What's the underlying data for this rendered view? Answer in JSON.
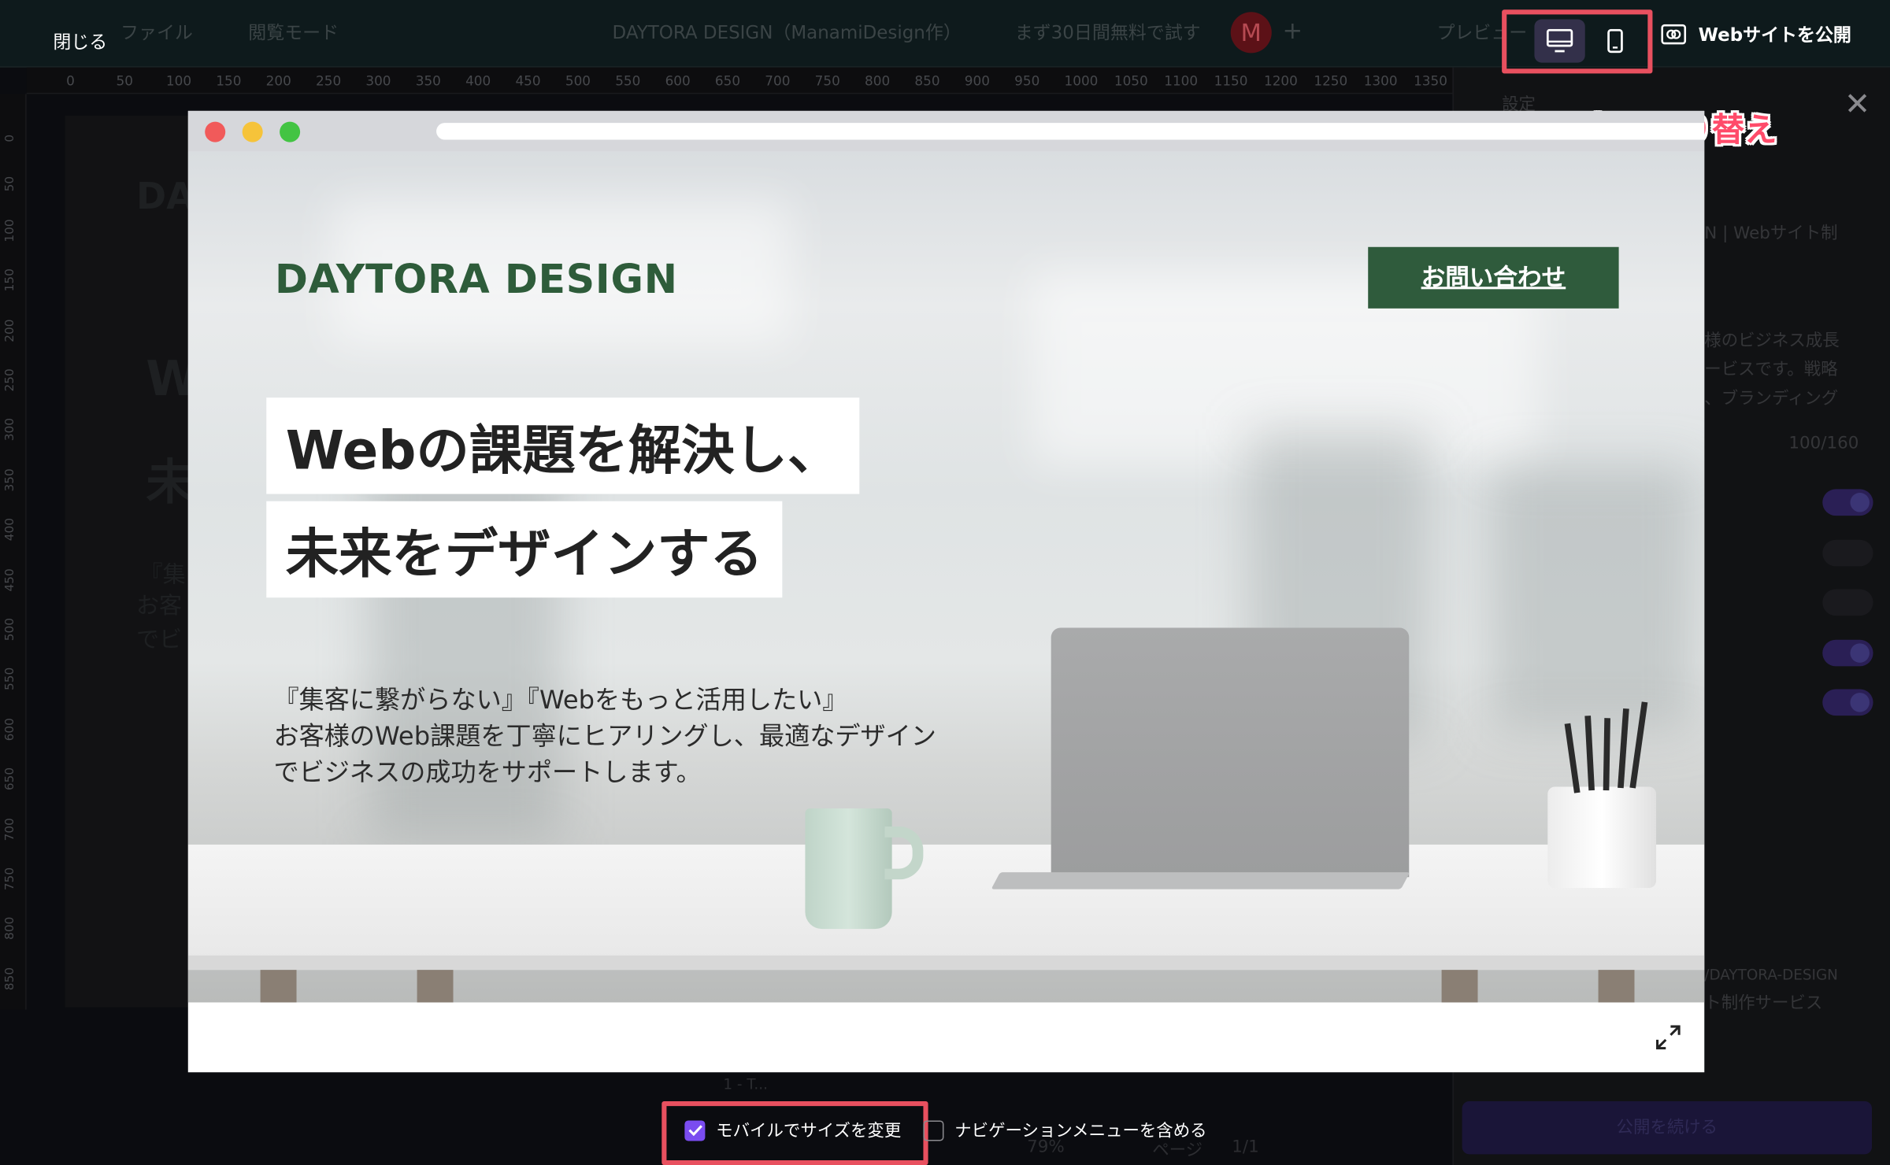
{
  "topbar": {
    "close_label": "閉じる",
    "file_label": "ファイル",
    "view_mode_label": "閲覧モード",
    "doc_title": "DAYTORA DESIGN（ManamiDesign作）",
    "trial_label": "まず30日間無料で試す",
    "avatar_initial": "M",
    "plus": "+",
    "preview_label": "プレビュー",
    "publish_web_label": "Webサイトを公開"
  },
  "annotation": {
    "device_toggle_caption": "パソコン・スマホ表示切り替え"
  },
  "ruler": {
    "h_ticks": [
      "0",
      "50",
      "100",
      "150",
      "200",
      "250",
      "300",
      "350",
      "400",
      "450",
      "500",
      "550",
      "600",
      "650",
      "700",
      "750",
      "800",
      "850",
      "900",
      "950",
      "1000",
      "1050",
      "1100",
      "1150",
      "1200",
      "1250",
      "1300",
      "1350"
    ],
    "v_ticks": [
      "0",
      "50",
      "100",
      "150",
      "200",
      "250",
      "300",
      "350",
      "400",
      "450",
      "500",
      "550",
      "600",
      "650",
      "700",
      "750",
      "800",
      "850"
    ]
  },
  "background_canvas": {
    "peek_brand": "DA",
    "peek_w": "W",
    "peek_mi": "未",
    "peek_line1": "『集",
    "peek_line2": "お客",
    "peek_line3": "でビ"
  },
  "right_panel": {
    "back_label": "設定",
    "title_snippet": "N | Webサイト制",
    "desc_lines": [
      "様のビジネス成長",
      "ービスです。戦略",
      "、ブランディング"
    ],
    "char_count": "100/160",
    "toggles": [
      true,
      false,
      false,
      true,
      true
    ],
    "thumb_caption_1": "/DAYTORA-DESIGN",
    "thumb_caption_2": "ト制作サービス",
    "continue_label": "公開を続ける"
  },
  "bottombar": {
    "page_chip": "1 - T...",
    "zoom": "79%",
    "pages_label": "ページ",
    "page_count": "1/1"
  },
  "preview": {
    "brand": "DAYTORA DESIGN",
    "contact_label": "お問い合わせ",
    "headline_1": "Webの課題を解決し、",
    "headline_2": "未来をデザインする",
    "body": [
      "『集客に繋がらない』『Webをもっと活用したい』",
      "お客様のWeb課題を丁寧にヒアリングし、最適なデザイン",
      "でビジネスの成功をサポートします。"
    ]
  },
  "options": {
    "mobile_resize_label": "モバイルでサイズを変更",
    "mobile_resize_checked": true,
    "include_nav_label": "ナビゲーションメニューを含める",
    "include_nav_checked": false
  },
  "device_mode": {
    "active": "desktop",
    "options": [
      "desktop-icon",
      "smartphone-icon"
    ]
  },
  "colors": {
    "brand_green": "#2e5c3a",
    "button_green": "#2f5b3c",
    "highlight_red": "#e8505f",
    "annotation_pink": "#ff4b6a",
    "checkbox_purple": "#7a4cf0"
  }
}
